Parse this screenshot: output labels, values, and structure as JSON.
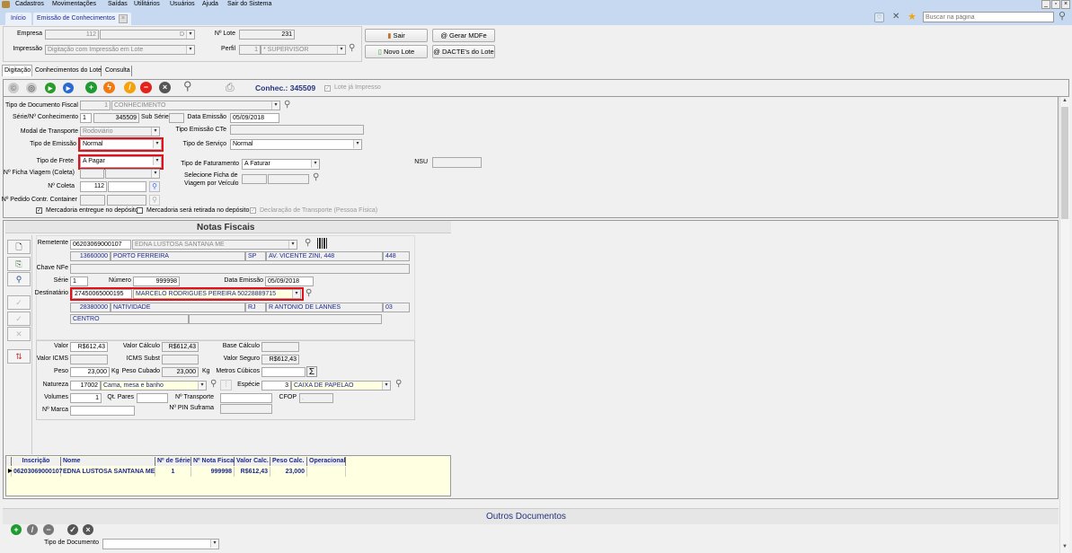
{
  "menu": [
    "Cadastros",
    "Movimentações",
    "Saídas",
    "Utilitários",
    "Usuários",
    "Ajuda",
    "Sair do Sistema"
  ],
  "tabs": {
    "home": "Início",
    "active": "Emissão de Conhecimentos"
  },
  "search": {
    "placeholder": "Buscar na página"
  },
  "header": {
    "empresa_label": "Empresa",
    "empresa_code": "112",
    "empresa_suffix": "D",
    "impressao_label": "Impressão",
    "impressao_value": "Digitação com Impressão em Lote",
    "lote_label": "Nº Lote",
    "lote_value": "231",
    "perfil_label": "Perfil",
    "perfil_code": "1",
    "perfil_value": "* SUPERVISOR",
    "sair": "Sair",
    "gerar_mdfe": "Gerar MDFe",
    "novo_lote": "Novo Lote",
    "dactes": "DACTE's do Lote"
  },
  "subtabs": [
    "Digitação",
    "Conhecimentos do Lote",
    "Consulta"
  ],
  "toolbar": {
    "conhec": "Conhec.: 345509",
    "lote_impresso": "Lote já Impresso"
  },
  "form": {
    "tipo_doc_label": "Tipo de Documento Fiscal",
    "tipo_doc_code": "1",
    "tipo_doc_value": "CONHECIMENTO",
    "serie_label": "Série/Nº Conhecimento",
    "serie": "1",
    "numero": "345509",
    "sub_serie_label": "Sub Série",
    "data_emissao_label": "Data Emissão",
    "data_emissao": "05/09/2018",
    "modal_label": "Modal de Transporte",
    "modal": "Rodoviário",
    "tipo_emissao_cte_label": "Tipo Emissão CTe",
    "tipo_emissao_label": "Tipo de Emissão",
    "tipo_emissao": "Normal",
    "tipo_servico_label": "Tipo de Serviço",
    "tipo_servico": "Normal",
    "tipo_frete_label": "Tipo de Frete",
    "tipo_frete": "A Pagar",
    "tipo_faturamento_label": "Tipo de Faturamento",
    "tipo_faturamento": "A Faturar",
    "nsu_label": "NSU",
    "ficha_label": "Nº Ficha Viagem (Coleta)",
    "selecione_ficha_label_1": "Selecione Ficha de",
    "selecione_ficha_label_2": "Viagem por Veículo",
    "coleta_label": "Nº Coleta",
    "coleta": "112",
    "pedido_label": "Nº Pedido Contr. Container",
    "cb_entregue": "Mercadoria entregue no depósito",
    "cb_retirada": "Mercadoria será retirada no depósito",
    "cb_declaracao": "Declaração de Transporte (Pessoa Física)"
  },
  "notas": {
    "title": "Notas Fiscais",
    "remetente_label": "Remetente",
    "remetente_doc": "06203069000107",
    "remetente_nome": "EDNA LUSTOSA SANTANA ME",
    "rem_cep": "13660000",
    "rem_cidade": "PORTO FERREIRA",
    "rem_uf": "SP",
    "rem_end": "AV. VICENTE ZINI, 448",
    "rem_num": "448",
    "chave_label": "Chave NFe",
    "serie_label": "Série",
    "serie": "1",
    "numero_label": "Número",
    "numero": "999998",
    "data_label": "Data Emissão",
    "data": "05/09/2018",
    "dest_label": "Destinatário",
    "dest_doc": "27450065000195",
    "dest_nome": "MARCELO RODRIGUES PEREIRA 50228889715",
    "dest_cep": "28380000",
    "dest_cidade": "NATIVIDADE",
    "dest_uf": "RJ",
    "dest_end": "R ANTONIO DE LANNES",
    "dest_num": "03",
    "dest_bairro": "CENTRO",
    "valor_label": "Valor",
    "valor": "R$612,43",
    "valor_calc_label": "Valor Cálculo",
    "valor_calc": "R$612,43",
    "base_label": "Base Cálculo",
    "icms_label": "Valor ICMS",
    "icms_subst_label": "ICMS Subst",
    "seguro_label": "Valor Seguro",
    "seguro": "R$612,43",
    "peso_label": "Peso",
    "peso": "23,000",
    "kg": "Kg",
    "peso_cub_label": "Peso Cubado",
    "peso_cub": "23,000",
    "metros_label": "Metros Cúbicos",
    "sigma": "Σ",
    "natureza_label": "Natureza",
    "natureza_code": "17002",
    "natureza": "Cama, mesa e banho",
    "especie_label": "Espécie",
    "especie_code": "3",
    "especie": "CAIXA DE PAPELAO",
    "volumes_label": "Volumes",
    "volumes": "1",
    "qt_pares_label": "Qt. Pares",
    "transporte_label": "Nº Transporte",
    "cfop_label": "CFOP",
    "cfop": ".",
    "marca_label": "Nº Marca",
    "pin_label": "Nº PIN Suframa"
  },
  "grid": {
    "columns": [
      "Inscrição",
      "Nome",
      "Nº de Série",
      "Nº Nota Fiscal",
      "Valor Calc.",
      "Peso Calc.",
      "Operacional"
    ],
    "rows": [
      [
        "06203069000107",
        "EDNA LUSTOSA SANTANA ME",
        "1",
        "999998",
        "R$612,43",
        "23,000",
        ""
      ]
    ]
  },
  "outros": {
    "title": "Outros Documentos",
    "tipo_doc_label": "Tipo de Documento"
  }
}
